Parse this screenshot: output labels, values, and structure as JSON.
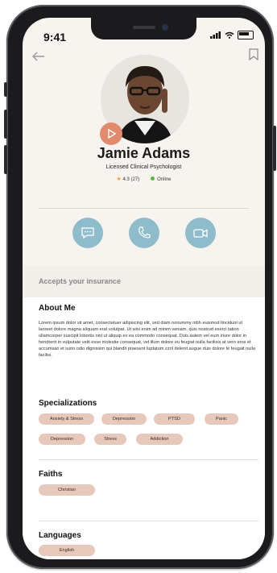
{
  "status_bar": {
    "time": "9:41"
  },
  "profile": {
    "name": "Jamie Adams",
    "title": "Licensed Clinical Psychologist",
    "rating": "4.3 (27)",
    "status": "Online"
  },
  "insurance": {
    "label": "Accepts your insurance"
  },
  "about": {
    "heading": "About Me",
    "text": "Lorem ipsum dolor sit amet, consectetuer adipiscing elit, sed diam nonummy nibh euismod tincidunt ut laoreet dolore magna aliquam erat volutpat. Ut wisi enim ad minim veniam, quis nostrud exerci tation ullamcorper suscipit lobortis nisl ut aliquip ex ea commodo consequat. Duis autem vel eum iriure dolor in hendrerit in vulputate velit esse molestie consequat, vel illum dolore eu feugiat nulla facilisis at vero eros et accumsan et iusto odio dignissim qui blandit praesent luptatum zzril delenit augue duis dolore te feugait nulla facilisi."
  },
  "specializations": {
    "heading": "Specializations",
    "items": [
      "Anxiety & Stress",
      "Depression",
      "PTSD",
      "Panic",
      "Depression",
      "Stress",
      "Addiction"
    ]
  },
  "faiths": {
    "heading": "Faiths",
    "items": [
      "Christian"
    ]
  },
  "languages": {
    "heading": "Languages",
    "items": [
      "English"
    ]
  },
  "colors": {
    "accent": "#8fbccb",
    "chip": "#e7c9bc",
    "play": "#e28b6c",
    "online": "#58b64c"
  },
  "icons": [
    "back-arrow-icon",
    "bookmark-icon",
    "play-icon",
    "chat-icon",
    "phone-icon",
    "video-icon",
    "star-icon"
  ]
}
